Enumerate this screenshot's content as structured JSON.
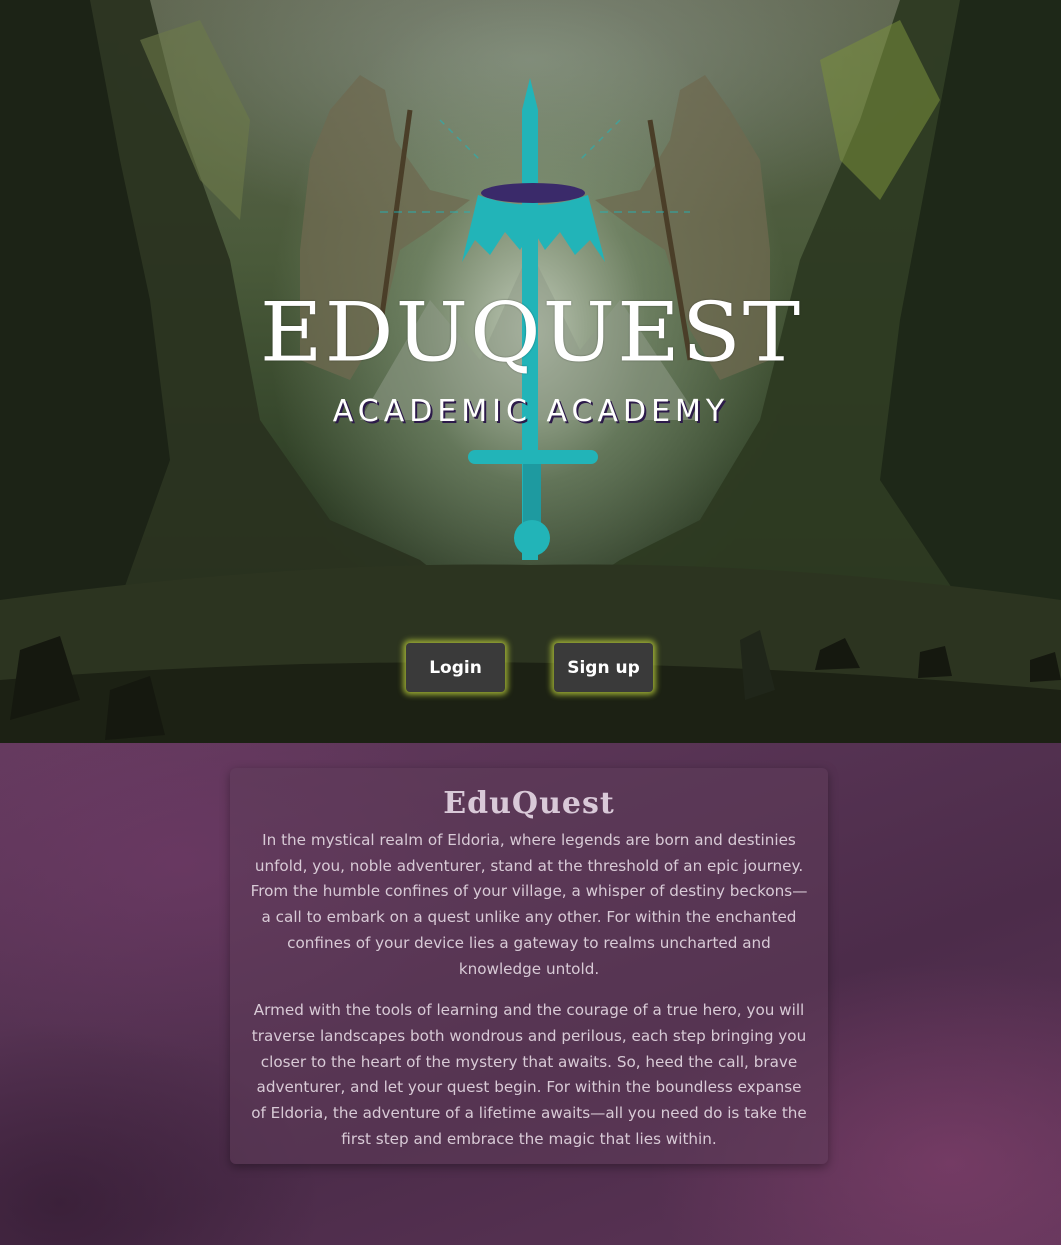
{
  "hero": {
    "logo_title": "EDUQUEST",
    "logo_subtitle": "ACADEMIC ACADEMY",
    "login_label": "Login",
    "signup_label": "Sign up",
    "button_glow_color": "#bed23c",
    "logo_accent_color": "#22b4b8"
  },
  "story": {
    "title": "EduQuest",
    "paragraphs": [
      "In the mystical realm of Eldoria, where legends are born and destinies unfold, you, noble adventurer, stand at the threshold of an epic journey. From the humble confines of your village, a whisper of destiny beckons—a call to embark on a quest unlike any other. For within the enchanted confines of your device lies a gateway to realms uncharted and knowledge untold.",
      "Armed with the tools of learning and the courage of a true hero, you will traverse landscapes both wondrous and perilous, each step bringing you closer to the heart of the mystery that awaits. So, heed the call, brave adventurer, and let your quest begin. For within the boundless expanse of Eldoria, the adventure of a lifetime awaits—all you need do is take the first step and embrace the magic that lies within."
    ]
  }
}
